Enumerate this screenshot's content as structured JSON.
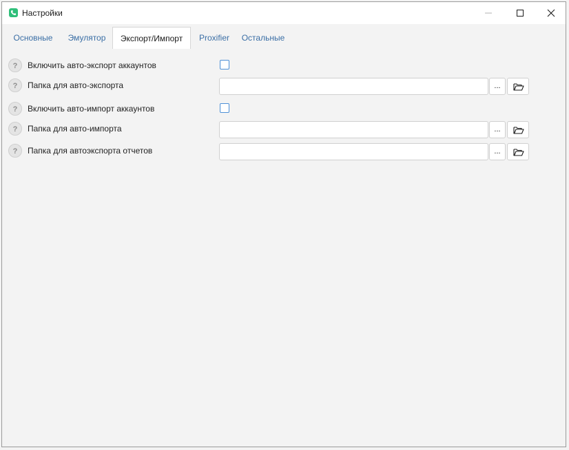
{
  "window": {
    "title": "Настройки",
    "accent_color": "#2fbf7a",
    "icons": {
      "app": "phone-icon",
      "minimize": "minimize-icon",
      "maximize": "maximize-icon",
      "close": "close-icon"
    }
  },
  "tabs": [
    {
      "label": "Основные",
      "active": false
    },
    {
      "label": "Эмулятор",
      "active": false
    },
    {
      "label": "Экспорт/Импорт",
      "active": true
    },
    {
      "label": "Proxifier",
      "active": false
    },
    {
      "label": "Остальные",
      "active": false
    }
  ],
  "settings": [
    {
      "label": "Включить авто-экспорт аккаунтов",
      "type": "checkbox",
      "checked": false
    },
    {
      "label": "Папка для авто-экспорта",
      "type": "path",
      "value": "",
      "browse_label": "..."
    },
    {
      "label": "Включить авто-импорт аккаунтов",
      "type": "checkbox",
      "checked": false
    },
    {
      "label": "Папка для авто-импорта",
      "type": "path",
      "value": "",
      "browse_label": "..."
    },
    {
      "label": "Папка для автоэкспорта отчетов",
      "type": "path",
      "value": "",
      "browse_label": "..."
    }
  ],
  "help_glyph": "?",
  "colors": {
    "tab_link": "#3a6ea5",
    "checkbox_border": "#4c8fd6"
  }
}
